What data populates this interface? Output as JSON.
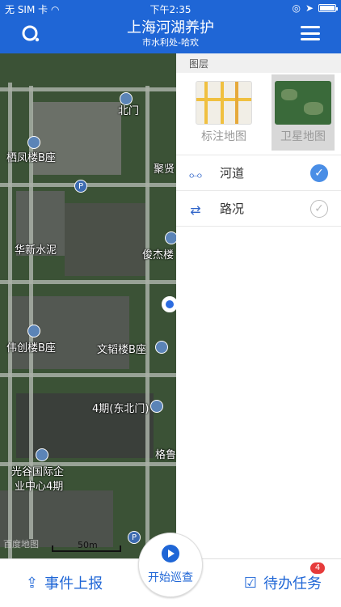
{
  "status_bar": {
    "carrier": "无 SIM 卡",
    "time": "下午2:35"
  },
  "header": {
    "title": "上海河湖养护",
    "subtitle": "市水利处-哈欢"
  },
  "map": {
    "labels": [
      "北门",
      "栖凤楼B座",
      "聚贤",
      "华新水泥",
      "俊杰楼",
      "伟创楼B座",
      "文韬楼B座",
      "4期(东北门)",
      "格鲁",
      "光谷国际企",
      "业中心4期"
    ],
    "scale": "50m",
    "watermark": "百度地图"
  },
  "layers": {
    "header": "图层",
    "types": [
      {
        "label": "标注地图",
        "selected": false
      },
      {
        "label": "卫星地图",
        "selected": true
      }
    ],
    "items": [
      {
        "label": "河道",
        "checked": true,
        "icon": "river-icon"
      },
      {
        "label": "路况",
        "checked": false,
        "icon": "traffic-icon"
      }
    ]
  },
  "bottom": {
    "report": "事件上报",
    "start": "开始巡查",
    "tasks": "待办任务",
    "tasks_badge": "4"
  },
  "colors": {
    "primary": "#1f66d6",
    "badge": "#e63b3b"
  }
}
